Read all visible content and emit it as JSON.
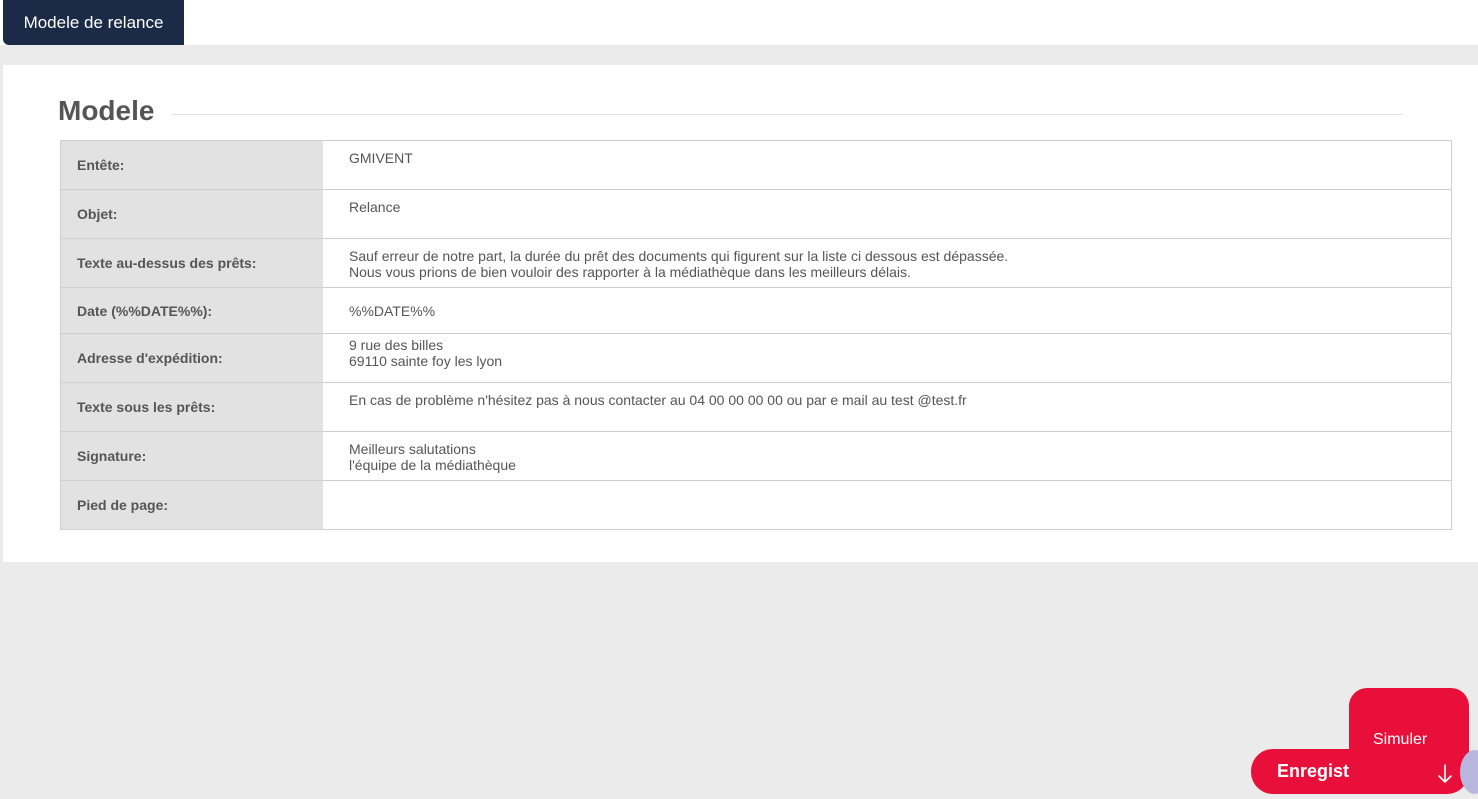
{
  "tab": {
    "label": "Modele de relance"
  },
  "section": {
    "title": "Modele"
  },
  "rows": [
    {
      "label": "Entête:",
      "value": "GMIVENT"
    },
    {
      "label": "Objet:",
      "value": "Relance"
    },
    {
      "label": "Texte au-dessus des prêts:",
      "value": "Sauf erreur de notre part, la durée du prêt des documents qui figurent sur la liste ci dessous est dépassée.\nNous vous prions de bien vouloir des rapporter à la médiathèque dans les meilleurs délais."
    },
    {
      "label": "Date (%%DATE%%):",
      "value": "%%DATE%%"
    },
    {
      "label": "Adresse d'expédition:",
      "value": "9 rue des billes\n69110 sainte foy les lyon"
    },
    {
      "label": "Texte sous les prêts:",
      "value": "En cas de problème n'hésitez pas à nous contacter au 04 00 00 00 00 ou par e mail au test @test.fr"
    },
    {
      "label": "Signature:",
      "value": "Meilleurs salutations\nl'équipe de la médiathèque"
    },
    {
      "label": "Pied de page:",
      "value": ""
    }
  ],
  "buttons": {
    "simuler": "Simuler",
    "enregistrer": "Enregist"
  },
  "icons": {
    "arrow": "arrow-down-icon",
    "chat": "chat-icon"
  },
  "colors": {
    "accent": "#e8103b",
    "tab_bg": "#1b2a47"
  }
}
